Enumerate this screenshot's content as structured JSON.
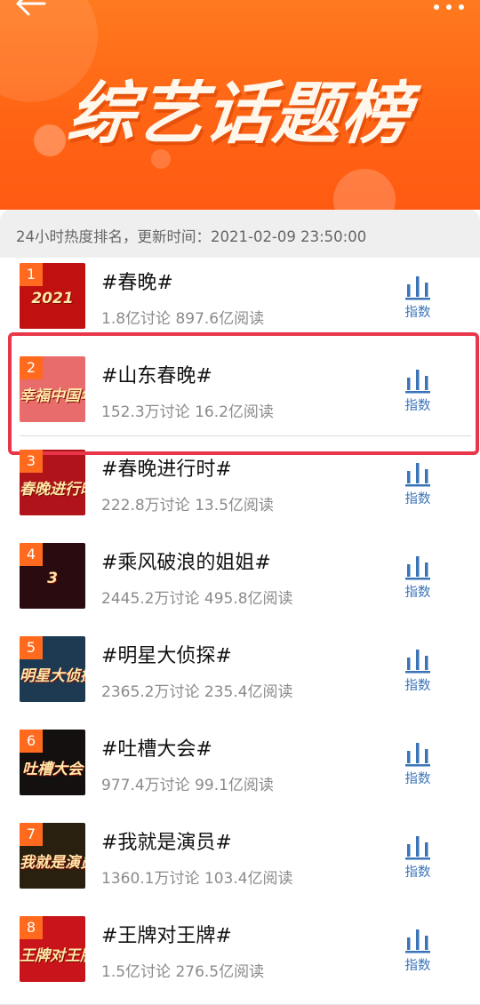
{
  "header": {
    "title": "综艺话题榜",
    "back_icon": "arrow-left-icon",
    "more_icon": "more-dots-icon"
  },
  "info": {
    "text": "24小时热度排名，更新时间：2021-02-09 23:50:00"
  },
  "accent_colors": {
    "banner": "#ff6414",
    "rank_badge": "#ff6a1f",
    "index_blue": "#3a73b8",
    "highlight": "#e8364a"
  },
  "items": [
    {
      "rank": "1",
      "topic": "#春晚#",
      "stats": "1.8亿讨论 897.6亿阅读",
      "index_label": "指数",
      "thumb_text": "2021",
      "thumb_bg": "#c01010"
    },
    {
      "rank": "2",
      "topic": "#山东春晚#",
      "stats": "152.3万讨论 16.2亿阅读",
      "index_label": "指数",
      "thumb_text": "幸福中国年",
      "thumb_bg": "#e96c6c"
    },
    {
      "rank": "3",
      "topic": "#春晚进行时#",
      "stats": "222.8万讨论 13.5亿阅读",
      "index_label": "指数",
      "thumb_text": "春晚进行时",
      "thumb_bg": "#b0141a"
    },
    {
      "rank": "4",
      "topic": "#乘风破浪的姐姐#",
      "stats": "2445.2万讨论 495.8亿阅读",
      "index_label": "指数",
      "thumb_text": "3",
      "thumb_bg": "#2a0c10"
    },
    {
      "rank": "5",
      "topic": "#明星大侦探#",
      "stats": "2365.2万讨论 235.4亿阅读",
      "index_label": "指数",
      "thumb_text": "明星大侦探",
      "thumb_bg": "#1d3a52"
    },
    {
      "rank": "6",
      "topic": "#吐槽大会#",
      "stats": "977.4万讨论 99.1亿阅读",
      "index_label": "指数",
      "thumb_text": "吐槽大会",
      "thumb_bg": "#141010"
    },
    {
      "rank": "7",
      "topic": "#我就是演员#",
      "stats": "1360.1万讨论 103.4亿阅读",
      "index_label": "指数",
      "thumb_text": "我就是演员",
      "thumb_bg": "#2a2010"
    },
    {
      "rank": "8",
      "topic": "#王牌对王牌#",
      "stats": "1.5亿讨论 276.5亿阅读",
      "index_label": "指数",
      "thumb_text": "王牌对王牌",
      "thumb_bg": "#c8141a"
    }
  ]
}
